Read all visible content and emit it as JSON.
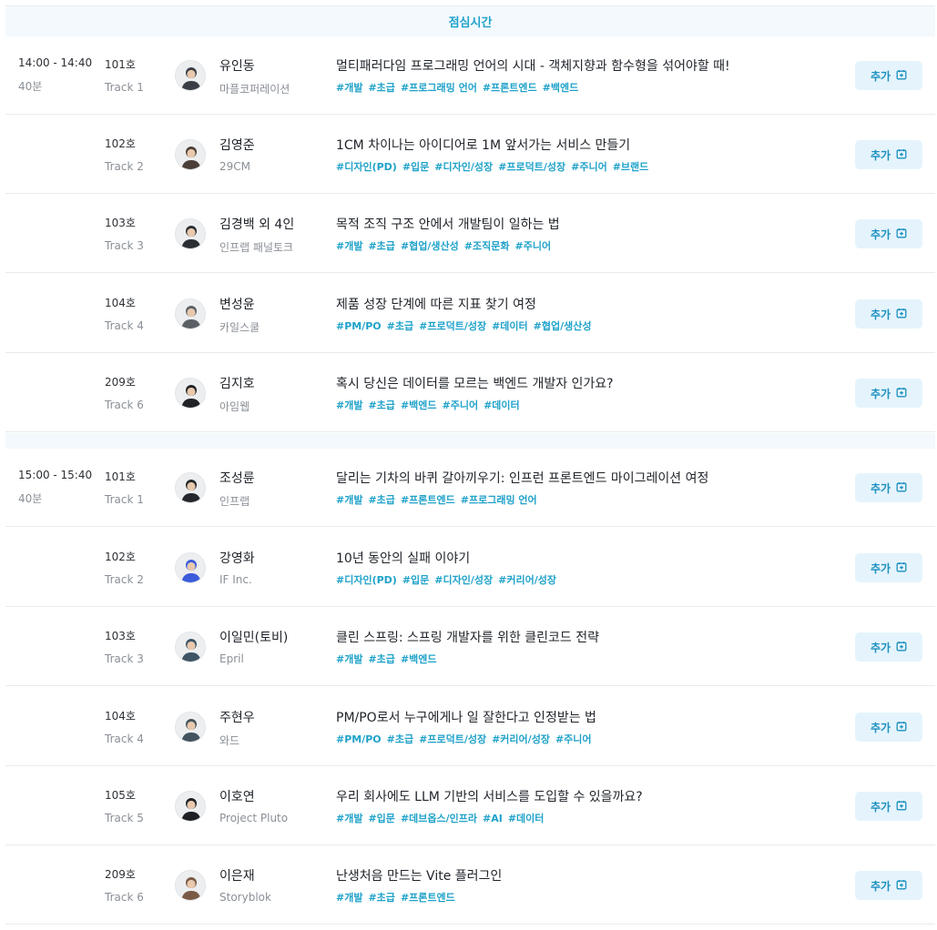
{
  "lunch": {
    "label": "점심시간"
  },
  "slots": [
    {
      "time": "14:00 - 14:40",
      "duration": "40분",
      "sessions": [
        {
          "room": "101호",
          "track": "Track 1",
          "speaker": "유인동",
          "company": "마플코퍼레이션",
          "title": "멀티패러다임 프로그래밍 언어의 시대 - 객체지향과 함수형을 섞어야할 때!",
          "tags": [
            "#개발",
            "#초급",
            "#프로그래밍 언어",
            "#프론트엔드",
            "#백엔드"
          ],
          "add_label": "추가",
          "avatar_color": "#3a3f45"
        },
        {
          "room": "102호",
          "track": "Track 2",
          "speaker": "김영준",
          "company": "29CM",
          "title": "1CM 차이나는 아이디어로 1M 앞서가는 서비스 만들기",
          "tags": [
            "#디자인(PD)",
            "#입문",
            "#디자인/성장",
            "#프로덕트/성장",
            "#주니어",
            "#브랜드"
          ],
          "add_label": "추가",
          "avatar_color": "#4a3f38"
        },
        {
          "room": "103호",
          "track": "Track 3",
          "speaker": "김경백 외 4인",
          "company": "인프랩 패널토크",
          "title": "목적 조직 구조 안에서 개발팀이 일하는 법",
          "tags": [
            "#개발",
            "#초급",
            "#협업/생산성",
            "#조직문화",
            "#주니어"
          ],
          "add_label": "추가",
          "avatar_color": "#2b2e33"
        },
        {
          "room": "104호",
          "track": "Track 4",
          "speaker": "변성윤",
          "company": "카일스쿨",
          "title": "제품 성장 단계에 따른 지표 찾기 여정",
          "tags": [
            "#PM/PO",
            "#초급",
            "#프로덕트/성장",
            "#데이터",
            "#협업/생산성"
          ],
          "add_label": "추가",
          "avatar_color": "#5a6066"
        },
        {
          "room": "209호",
          "track": "Track 6",
          "speaker": "김지호",
          "company": "아임웹",
          "title": "혹시 당신은 데이터를 모르는 백엔드 개발자 인가요?",
          "tags": [
            "#개발",
            "#초급",
            "#백엔드",
            "#주니어",
            "#데이터"
          ],
          "add_label": "추가",
          "avatar_color": "#202226"
        }
      ]
    },
    {
      "time": "15:00 - 15:40",
      "duration": "40분",
      "sessions": [
        {
          "room": "101호",
          "track": "Track 1",
          "speaker": "조성륜",
          "company": "인프랩",
          "title": "달리는 기차의 바퀴 갈아끼우기: 인프런 프론트엔드 마이그레이션 여정",
          "tags": [
            "#개발",
            "#초급",
            "#프론트엔드",
            "#프로그래밍 언어"
          ],
          "add_label": "추가",
          "avatar_color": "#24272b"
        },
        {
          "room": "102호",
          "track": "Track 2",
          "speaker": "강영화",
          "company": "IF Inc.",
          "title": "10년 동안의 실패 이야기",
          "tags": [
            "#디자인(PD)",
            "#입문",
            "#디자인/성장",
            "#커리어/성장"
          ],
          "add_label": "추가",
          "avatar_color": "#3b5bdb"
        },
        {
          "room": "103호",
          "track": "Track 3",
          "speaker": "이일민(토비)",
          "company": "Epril",
          "title": "클린 스프링: 스프링 개발자를 위한 클린코드 전략",
          "tags": [
            "#개발",
            "#초급",
            "#백엔드"
          ],
          "add_label": "추가",
          "avatar_color": "#3e5566"
        },
        {
          "room": "104호",
          "track": "Track 4",
          "speaker": "주현우",
          "company": "와드",
          "title": "PM/PO로서 누구에게나 일 잘한다고 인정받는 법",
          "tags": [
            "#PM/PO",
            "#초급",
            "#프로덕트/성장",
            "#커리어/성장",
            "#주니어"
          ],
          "add_label": "추가",
          "avatar_color": "#44545e"
        },
        {
          "room": "105호",
          "track": "Track 5",
          "speaker": "이호연",
          "company": "Project Pluto",
          "title": "우리 회사에도 LLM 기반의 서비스를 도입할 수 있을까요?",
          "tags": [
            "#개발",
            "#입문",
            "#데브옵스/인프라",
            "#AI",
            "#데이터"
          ],
          "add_label": "추가",
          "avatar_color": "#1e2024"
        },
        {
          "room": "209호",
          "track": "Track 6",
          "speaker": "이은재",
          "company": "Storyblok",
          "title": "난생처음 만드는 Vite 플러그인",
          "tags": [
            "#개발",
            "#초급",
            "#프론트엔드"
          ],
          "add_label": "추가",
          "avatar_color": "#7a5a45"
        }
      ]
    }
  ]
}
